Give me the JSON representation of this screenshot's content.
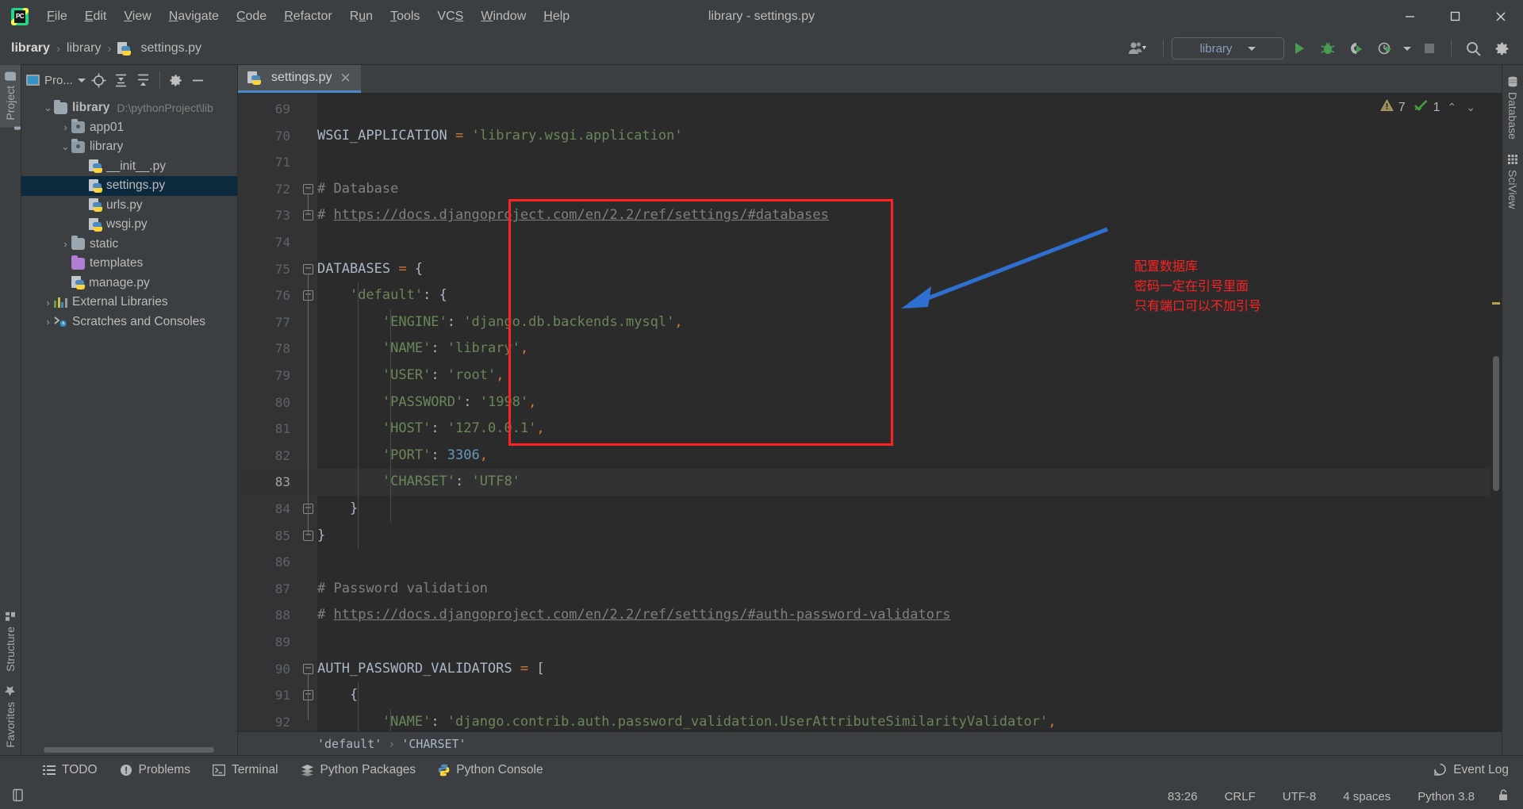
{
  "window": {
    "title": "library - settings.py",
    "logo_text": "PC",
    "minimize": "–",
    "maximize": "❑",
    "close": "✕"
  },
  "menu": [
    {
      "label": "File",
      "mnemonic": "F"
    },
    {
      "label": "Edit",
      "mnemonic": "E"
    },
    {
      "label": "View",
      "mnemonic": "V"
    },
    {
      "label": "Navigate",
      "mnemonic": "N"
    },
    {
      "label": "Code",
      "mnemonic": "C"
    },
    {
      "label": "Refactor",
      "mnemonic": "R"
    },
    {
      "label": "Run",
      "mnemonic": "u"
    },
    {
      "label": "Tools",
      "mnemonic": "T"
    },
    {
      "label": "VCS",
      "mnemonic": "S"
    },
    {
      "label": "Window",
      "mnemonic": "W"
    },
    {
      "label": "Help",
      "mnemonic": "H"
    }
  ],
  "navbar": {
    "breadcrumb": [
      "library",
      "library",
      "settings.py"
    ],
    "run_config": "library",
    "icons": [
      "user-avatar-icon",
      "run-icon",
      "debug-icon",
      "run-coverage-icon",
      "profile-icon",
      "stop-icon",
      "search-everywhere-icon",
      "settings-gear-icon"
    ]
  },
  "left_stripe": [
    {
      "label": "Project",
      "icon": "project-folder-icon",
      "selected": true
    },
    {
      "label": "Structure",
      "icon": "structure-icon",
      "selected": false
    },
    {
      "label": "Favorites",
      "icon": "favorites-star-icon",
      "selected": false
    }
  ],
  "right_stripe": [
    {
      "label": "Database",
      "icon": "database-icon"
    },
    {
      "label": "SciView",
      "icon": "sciview-grid-icon"
    }
  ],
  "project_panel": {
    "title": "Pro...",
    "toolbar_icons": [
      "locate-icon",
      "expand-all-icon",
      "collapse-all-icon",
      "settings-gear-icon",
      "hide-icon"
    ],
    "tree": [
      {
        "label": "library",
        "detail": "D:\\pythonProject\\lib",
        "icon": "folder-icon",
        "indent": 0,
        "arrow": "⌄",
        "bold": true,
        "selected": false
      },
      {
        "label": "app01",
        "detail": "",
        "icon": "source-folder-icon",
        "indent": 1,
        "arrow": "›",
        "bold": false,
        "selected": false
      },
      {
        "label": "library",
        "detail": "",
        "icon": "source-folder-icon",
        "indent": 1,
        "arrow": "⌄",
        "bold": false,
        "selected": false
      },
      {
        "label": "__init__.py",
        "detail": "",
        "icon": "python-file-icon",
        "indent": 2,
        "arrow": "",
        "bold": false,
        "selected": false
      },
      {
        "label": "settings.py",
        "detail": "",
        "icon": "python-file-icon",
        "indent": 2,
        "arrow": "",
        "bold": false,
        "selected": true
      },
      {
        "label": "urls.py",
        "detail": "",
        "icon": "python-file-icon",
        "indent": 2,
        "arrow": "",
        "bold": false,
        "selected": false
      },
      {
        "label": "wsgi.py",
        "detail": "",
        "icon": "python-file-icon",
        "indent": 2,
        "arrow": "",
        "bold": false,
        "selected": false
      },
      {
        "label": "static",
        "detail": "",
        "icon": "folder-icon",
        "indent": 1,
        "arrow": "›",
        "bold": false,
        "selected": false
      },
      {
        "label": "templates",
        "detail": "",
        "icon": "templates-folder-icon",
        "indent": 1,
        "arrow": "",
        "bold": false,
        "selected": false
      },
      {
        "label": "manage.py",
        "detail": "",
        "icon": "python-file-icon",
        "indent": 1,
        "arrow": "",
        "bold": false,
        "selected": false
      },
      {
        "label": "External Libraries",
        "detail": "",
        "icon": "external-libraries-icon",
        "indent": 0,
        "arrow": "›",
        "bold": false,
        "selected": false
      },
      {
        "label": "Scratches and Consoles",
        "detail": "",
        "icon": "scratches-icon",
        "indent": 0,
        "arrow": "›",
        "bold": false,
        "selected": false
      }
    ]
  },
  "editor": {
    "tab": {
      "label": "settings.py",
      "icon": "python-file-icon",
      "close": "✕"
    },
    "inspection": {
      "warning_count": "7",
      "ok_count": "1",
      "prev": "⌃",
      "next": "⌄"
    },
    "first_line": 69,
    "current_line": 83,
    "lines": [
      {
        "n": 69,
        "tokens": []
      },
      {
        "n": 70,
        "tokens": [
          {
            "t": "WSGI_APPLICATION ",
            "c": "def"
          },
          {
            "t": "= ",
            "c": "kw"
          },
          {
            "t": "'library.wsgi.application'",
            "c": "str"
          }
        ]
      },
      {
        "n": 71,
        "tokens": []
      },
      {
        "n": 72,
        "tokens": [
          {
            "t": "# Database",
            "c": "cm"
          }
        ]
      },
      {
        "n": 73,
        "tokens": [
          {
            "t": "# ",
            "c": "cm"
          },
          {
            "t": "https://docs.djangoproject.com/en/2.2/ref/settings/#databases",
            "c": "lnk"
          }
        ]
      },
      {
        "n": 74,
        "tokens": []
      },
      {
        "n": 75,
        "tokens": [
          {
            "t": "DATABASES ",
            "c": "def"
          },
          {
            "t": "= ",
            "c": "kw"
          },
          {
            "t": "{",
            "c": "def"
          }
        ]
      },
      {
        "n": 76,
        "tokens": [
          {
            "t": "    ",
            "c": "def"
          },
          {
            "t": "'default'",
            "c": "str"
          },
          {
            "t": ": ",
            "c": "def"
          },
          {
            "t": "{",
            "c": "def"
          }
        ]
      },
      {
        "n": 77,
        "tokens": [
          {
            "t": "        ",
            "c": "def"
          },
          {
            "t": "'ENGINE'",
            "c": "str"
          },
          {
            "t": ": ",
            "c": "def"
          },
          {
            "t": "'django.db.backends.mysql'",
            "c": "str"
          },
          {
            "t": ",",
            "c": "comma"
          }
        ]
      },
      {
        "n": 78,
        "tokens": [
          {
            "t": "        ",
            "c": "def"
          },
          {
            "t": "'NAME'",
            "c": "str"
          },
          {
            "t": ": ",
            "c": "def"
          },
          {
            "t": "'library'",
            "c": "str"
          },
          {
            "t": ",",
            "c": "comma"
          }
        ]
      },
      {
        "n": 79,
        "tokens": [
          {
            "t": "        ",
            "c": "def"
          },
          {
            "t": "'USER'",
            "c": "str"
          },
          {
            "t": ": ",
            "c": "def"
          },
          {
            "t": "'root'",
            "c": "str"
          },
          {
            "t": ",",
            "c": "comma"
          }
        ]
      },
      {
        "n": 80,
        "tokens": [
          {
            "t": "        ",
            "c": "def"
          },
          {
            "t": "'PASSWORD'",
            "c": "str"
          },
          {
            "t": ": ",
            "c": "def"
          },
          {
            "t": "'1998'",
            "c": "str"
          },
          {
            "t": ",",
            "c": "comma"
          }
        ]
      },
      {
        "n": 81,
        "tokens": [
          {
            "t": "        ",
            "c": "def"
          },
          {
            "t": "'HOST'",
            "c": "str"
          },
          {
            "t": ": ",
            "c": "def"
          },
          {
            "t": "'127.0.0.1'",
            "c": "str"
          },
          {
            "t": ",",
            "c": "comma"
          }
        ]
      },
      {
        "n": 82,
        "tokens": [
          {
            "t": "        ",
            "c": "def"
          },
          {
            "t": "'PORT'",
            "c": "str"
          },
          {
            "t": ": ",
            "c": "def"
          },
          {
            "t": "3306",
            "c": "num"
          },
          {
            "t": ",",
            "c": "comma"
          }
        ]
      },
      {
        "n": 83,
        "tokens": [
          {
            "t": "        ",
            "c": "def"
          },
          {
            "t": "'CHARSET'",
            "c": "str"
          },
          {
            "t": ": ",
            "c": "def"
          },
          {
            "t": "'UTF8'",
            "c": "str"
          }
        ]
      },
      {
        "n": 84,
        "tokens": [
          {
            "t": "    }",
            "c": "def"
          }
        ]
      },
      {
        "n": 85,
        "tokens": [
          {
            "t": "}",
            "c": "def"
          }
        ]
      },
      {
        "n": 86,
        "tokens": []
      },
      {
        "n": 87,
        "tokens": [
          {
            "t": "# Password validation",
            "c": "cm"
          }
        ]
      },
      {
        "n": 88,
        "tokens": [
          {
            "t": "# ",
            "c": "cm"
          },
          {
            "t": "https://docs.djangoproject.com/en/2.2/ref/settings/#auth-password-validators",
            "c": "lnk"
          }
        ]
      },
      {
        "n": 89,
        "tokens": []
      },
      {
        "n": 90,
        "tokens": [
          {
            "t": "AUTH_PASSWORD_VALIDATORS ",
            "c": "def"
          },
          {
            "t": "= ",
            "c": "kw"
          },
          {
            "t": "[",
            "c": "def"
          }
        ]
      },
      {
        "n": 91,
        "tokens": [
          {
            "t": "    {",
            "c": "def"
          }
        ]
      },
      {
        "n": 92,
        "tokens": [
          {
            "t": "        ",
            "c": "def"
          },
          {
            "t": "'NAME'",
            "c": "str"
          },
          {
            "t": ": ",
            "c": "def"
          },
          {
            "t": "'django.contrib.auth.password_validation.UserAttributeSimilarityValidator'",
            "c": "str"
          },
          {
            "t": ",",
            "c": "comma"
          }
        ]
      }
    ],
    "breadcrumbs": [
      "'default'",
      "'CHARSET'"
    ]
  },
  "annotation": {
    "color": "#ff2222",
    "arrow_color": "#2f6fd0",
    "lines": [
      "配置数据库",
      "密码一定在引号里面",
      "只有端口可以不加引号"
    ]
  },
  "tool_windows": [
    {
      "label": "TODO",
      "icon": "todo-list-icon"
    },
    {
      "label": "Problems",
      "icon": "problems-icon"
    },
    {
      "label": "Terminal",
      "icon": "terminal-icon"
    },
    {
      "label": "Python Packages",
      "icon": "python-packages-icon"
    },
    {
      "label": "Python Console",
      "icon": "python-console-icon"
    }
  ],
  "event_log": {
    "label": "Event Log",
    "icon": "event-log-icon"
  },
  "status": {
    "caret": "83:26",
    "line_separator": "CRLF",
    "encoding": "UTF-8",
    "indent": "4 spaces",
    "interpreter": "Python 3.8",
    "lock_icon": "unlocked-icon"
  }
}
